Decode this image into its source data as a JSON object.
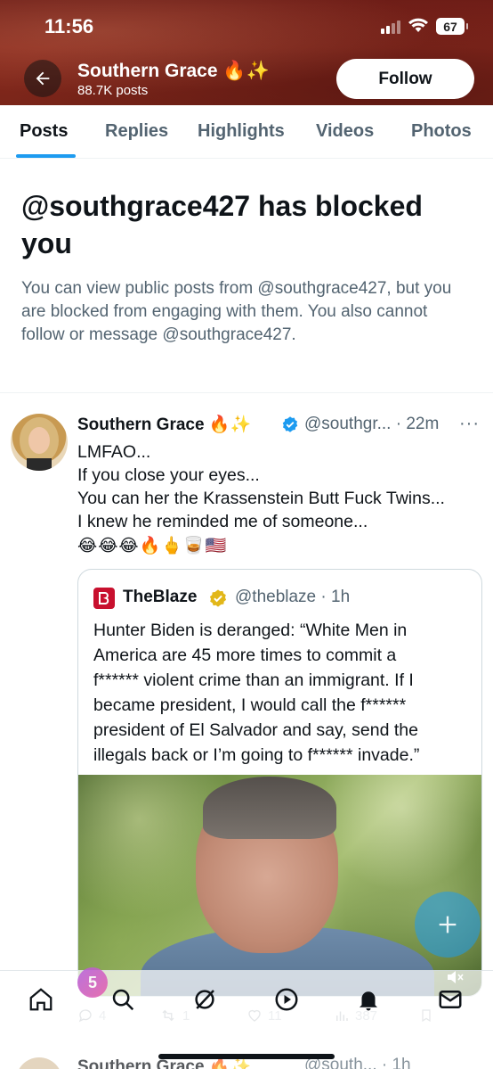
{
  "status_bar": {
    "time": "11:56",
    "battery": "67"
  },
  "profile_header": {
    "name": "Southern Grace 🔥✨",
    "post_count": "88.7K posts",
    "follow_label": "Follow"
  },
  "tabs": [
    {
      "label": "Posts",
      "active": true
    },
    {
      "label": "Replies",
      "active": false
    },
    {
      "label": "Highlights",
      "active": false
    },
    {
      "label": "Videos",
      "active": false
    },
    {
      "label": "Photos",
      "active": false
    }
  ],
  "blocked_notice": {
    "title": "@southgrace427 has blocked you",
    "description": "You can view public posts from @southgrace427, but you are blocked from engaging with them. You also cannot follow or message @southgrace427."
  },
  "tweet": {
    "author": "Southern Grace 🔥✨",
    "handle_time": "@southgr... · 22m",
    "lines": [
      "LMFAO...",
      "If you close your eyes...",
      "You can her the Krassenstein Butt Fuck Twins...",
      "I knew he reminded me of someone..."
    ],
    "emojis": "😂😂😂🔥🖕🥃🇺🇸",
    "quoted": {
      "author": "TheBlaze",
      "handle_time": "@theblaze · 1h",
      "lines": [
        "Hunter Biden is deranged: “White Men in",
        "America are 45 more times to commit a",
        "f****** violent crime than an immigrant. If I",
        "became president, I would call the f******",
        "president of El Salvador and say, send the",
        "illegals back or I’m going to f****** invade.”"
      ]
    },
    "stats": {
      "replies": "4",
      "reposts": "1",
      "likes": "11",
      "views": "387"
    }
  },
  "spaces_badge": "5",
  "next_tweet": {
    "author": "Southern Grace 🔥✨",
    "handle_time": "@south... · 1h"
  },
  "colors": {
    "accent": "#1d9bf0",
    "header_bg": "#7a2519",
    "secondary_text": "#536471",
    "verified_gold": "#e2b719"
  }
}
